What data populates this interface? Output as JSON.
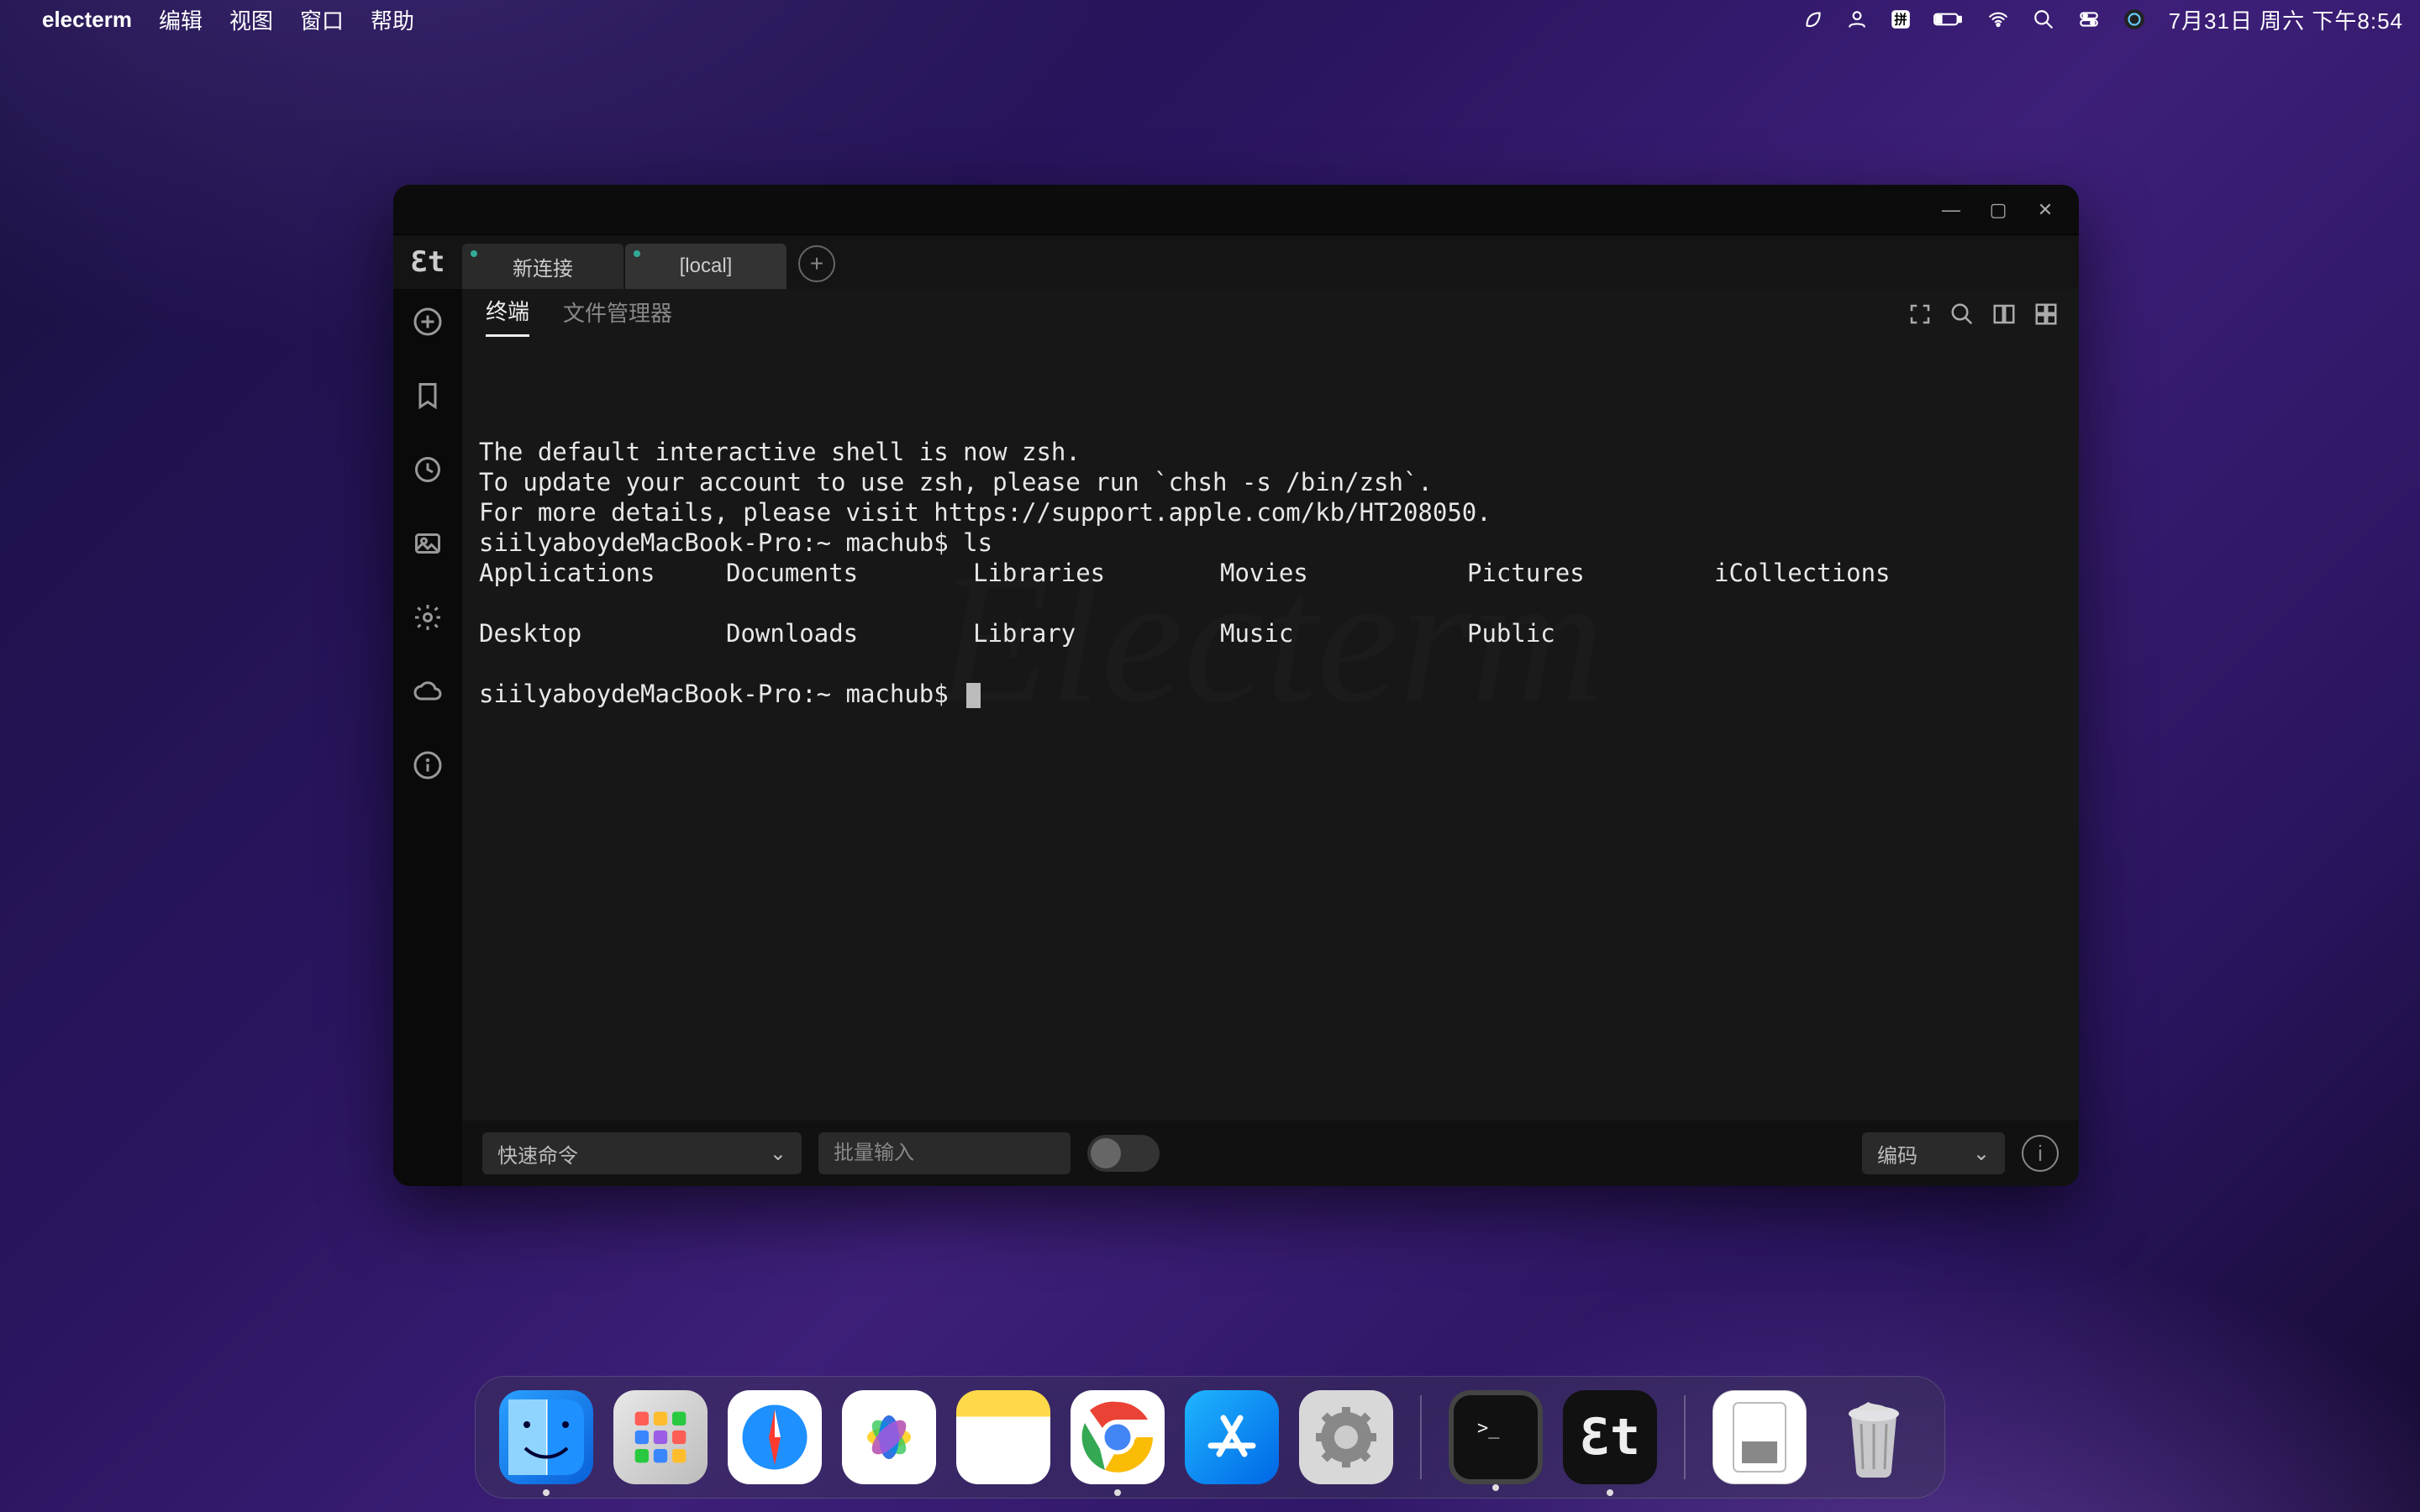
{
  "menubar": {
    "app_name": "electerm",
    "items": [
      "编辑",
      "视图",
      "窗口",
      "帮助"
    ],
    "clock": "7月31日 周六 下午8:54"
  },
  "window": {
    "tabs": [
      {
        "label": "新连接",
        "active": false
      },
      {
        "label": "[local]",
        "active": true
      }
    ],
    "subtabs": {
      "terminal": "终端",
      "file_manager": "文件管理器"
    },
    "terminal": {
      "line1": "The default interactive shell is now zsh.",
      "line2": "To update your account to use zsh, please run `chsh -s /bin/zsh`.",
      "line3": "For more details, please visit https://support.apple.com/kb/HT208050.",
      "prompt1": "siilyaboydeMacBook-Pro:~ machub$ ",
      "cmd1": "ls",
      "ls_cols": [
        "Applications",
        "Documents",
        "Libraries",
        "Movies",
        "Pictures",
        "iCollections"
      ],
      "ls_cols2": [
        "Desktop",
        "Downloads",
        "Library",
        "Music",
        "Public",
        ""
      ],
      "prompt2": "siilyaboydeMacBook-Pro:~ machub$ ",
      "watermark": "Electerm"
    },
    "bottom": {
      "quick_cmd": "快速命令",
      "batch_input_placeholder": "批量输入",
      "encoding": "编码"
    }
  },
  "dock": {
    "items": [
      {
        "name": "finder",
        "running": true
      },
      {
        "name": "launchpad",
        "running": false
      },
      {
        "name": "safari",
        "running": false
      },
      {
        "name": "photos",
        "running": false
      },
      {
        "name": "notes",
        "running": false
      },
      {
        "name": "chrome",
        "running": true
      },
      {
        "name": "appstore",
        "running": false
      },
      {
        "name": "settings",
        "running": false
      }
    ],
    "recent": [
      {
        "name": "terminal",
        "running": true
      },
      {
        "name": "electerm",
        "running": true
      }
    ],
    "right": [
      {
        "name": "document",
        "running": false
      },
      {
        "name": "trash",
        "running": false
      }
    ]
  }
}
